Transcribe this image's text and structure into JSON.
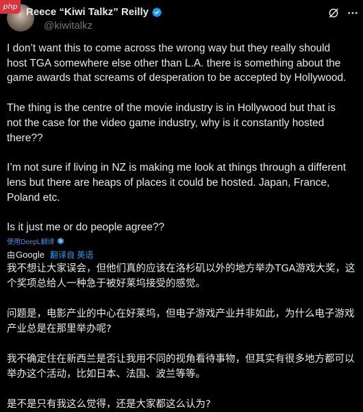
{
  "watermark": "php",
  "author": {
    "display_name": "Reece “Kiwi Talkz” Reilly",
    "handle": "@kiwitalkz"
  },
  "icons": {
    "verified": "verified-badge-icon",
    "grok": "grok-icon",
    "more": "more-options-icon",
    "deepl": "deepl-icon"
  },
  "colors": {
    "background": "#000000",
    "text": "#e7e9ea",
    "secondary": "#71767b",
    "link": "#1d9bf0",
    "verified": "#1d9bf0"
  },
  "post": {
    "p1_l1": "I don’t want this to come across the wrong way but they really should",
    "p1_l2": "host TGA somewhere else other than L.A. there is something about the",
    "p1_l3": "game awards that screams of desperation to be accepted by Hollywood.",
    "p2_l1": "The thing is the centre of the movie industry is in Hollywood but that is",
    "p2_l2": "not the case for the video game industry, why is it constantly hosted",
    "p2_l3": "there??",
    "p3_l1": "I’m not sure if living in NZ is making me look at things through a different",
    "p3_l2": "lens but there are heaps of places it could be hosted. Japan, France,",
    "p3_l3": "Poland etc.",
    "p4_l1": "Is it just me or do people agree??"
  },
  "deepl_link": "使用DeepL翻译",
  "google": {
    "prefix": "由",
    "brand": "Google",
    "link": "翻译自 英语"
  },
  "translation": {
    "p1": "我不想让大家误会，但他们真的应该在洛杉矶以外的地方举办TGA游戏大奖，这个奖项总给人一种急于被好莱坞接受的感觉。",
    "p2": "问题是，电影产业的中心在好莱坞，但电子游戏产业并非如此，为什么电子游戏产业总是在那里举办呢?",
    "p3": "我不确定住在新西兰是否让我用不同的视角看待事物，但其实有很多地方都可以举办这个活动，比如日本、法国、波兰等等。",
    "p4": "是不是只有我这么觉得，还是大家都这么认为?"
  }
}
